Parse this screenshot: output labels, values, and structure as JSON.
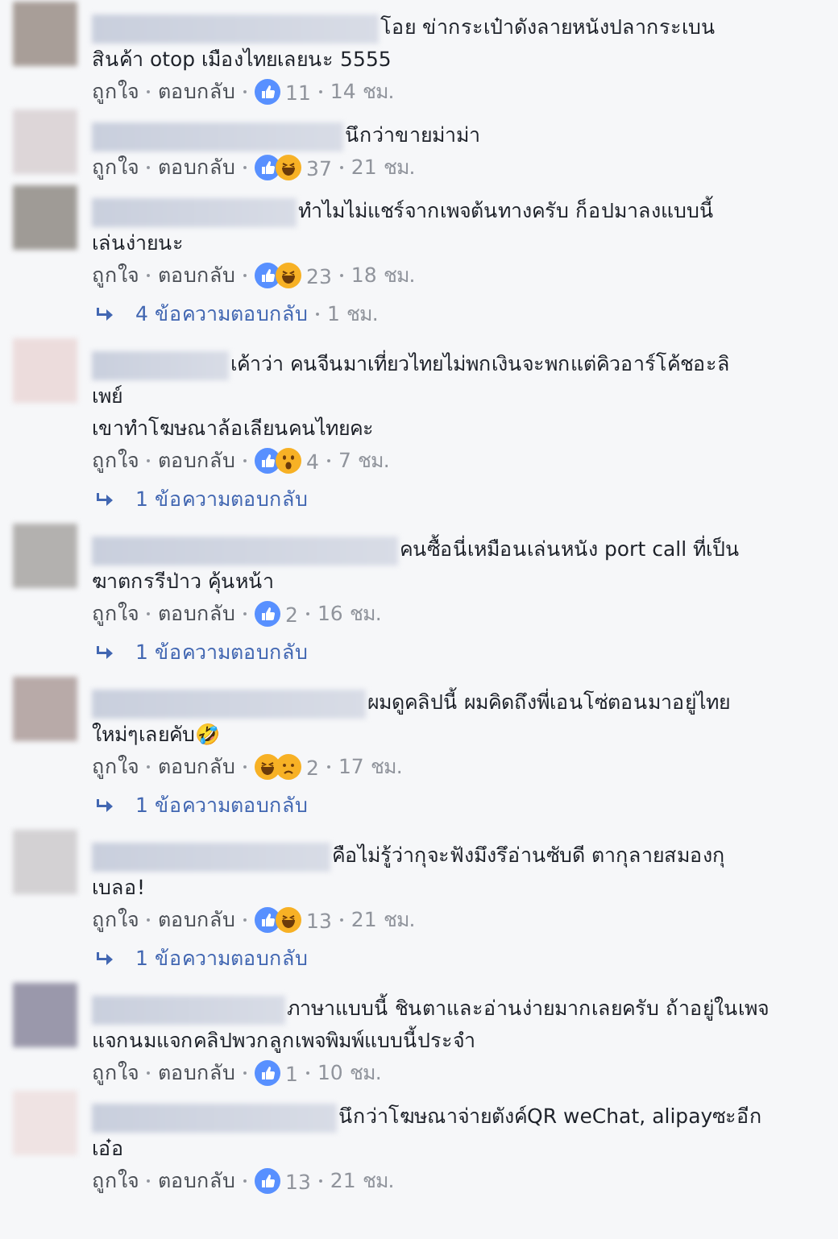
{
  "comments": [
    {
      "lines": [
        "โอย ข่ากระเป๋าดังลายหนังปลากระเบน",
        "สินค้า otop เมืองไทยเลยนะ 5555"
      ],
      "like_label": "ถูกใจ",
      "reply_label": "ตอบกลับ",
      "reactions": [
        {
          "kind": "like"
        }
      ],
      "count": "11",
      "time": "14 ชม."
    },
    {
      "lines": [
        "นึกว่าขายม่าม่า"
      ],
      "like_label": "ถูกใจ",
      "reply_label": "ตอบกลับ",
      "reactions": [
        {
          "kind": "like"
        },
        {
          "kind": "haha"
        }
      ],
      "count": "37",
      "time": "21 ชม."
    },
    {
      "lines": [
        "ทำไมไม่แชร์จากเพจต้นทางครับ ก็อปมาลงแบบนี้",
        "เล่นง่ายนะ"
      ],
      "like_label": "ถูกใจ",
      "reply_label": "ตอบกลับ",
      "reactions": [
        {
          "kind": "like"
        },
        {
          "kind": "haha"
        }
      ],
      "count": "23",
      "time": "18 ชม.",
      "replies": {
        "label": "4 ข้อความตอบกลับ",
        "time": "1 ชม."
      }
    },
    {
      "lines": [
        "เค้าว่า คนจีนมาเที่ยวไทยไม่พกเงินจะพกแต่คิวอาร์โค้ชอะลิ",
        "เพย์",
        "เขาทำโฆษณาล้อเลียนคนไทยคะ"
      ],
      "like_label": "ถูกใจ",
      "reply_label": "ตอบกลับ",
      "reactions": [
        {
          "kind": "like"
        },
        {
          "kind": "wow"
        }
      ],
      "count": "4",
      "time": "7 ชม.",
      "replies": {
        "label": "1 ข้อความตอบกลับ"
      }
    },
    {
      "lines": [
        "คนซื้อนี่เหมือนเล่นหนัง port call ที่เป็น",
        "ฆาตกรรีป่าว คุ้นหน้า"
      ],
      "like_label": "ถูกใจ",
      "reply_label": "ตอบกลับ",
      "reactions": [
        {
          "kind": "like"
        }
      ],
      "count": "2",
      "time": "16 ชม.",
      "replies": {
        "label": "1 ข้อความตอบกลับ"
      }
    },
    {
      "lines": [
        "ผมดูคลิปนี้ ผมคิดถึงพี่เอนโซ่ตอนมาอยู่ไทย",
        "ใหม่ๆเลยคับ🤣"
      ],
      "like_label": "ถูกใจ",
      "reply_label": "ตอบกลับ",
      "reactions": [
        {
          "kind": "haha"
        },
        {
          "kind": "sad"
        }
      ],
      "count": "2",
      "time": "17 ชม.",
      "replies": {
        "label": "1 ข้อความตอบกลับ"
      }
    },
    {
      "lines": [
        "คือไม่รู้ว่ากุจะฟังมึงรึอ่านซับดี ตากุลายสมองกุ",
        "เบลอ!"
      ],
      "like_label": "ถูกใจ",
      "reply_label": "ตอบกลับ",
      "reactions": [
        {
          "kind": "like"
        },
        {
          "kind": "haha"
        }
      ],
      "count": "13",
      "time": "21 ชม.",
      "replies": {
        "label": "1 ข้อความตอบกลับ"
      }
    },
    {
      "lines": [
        "ภาษาแบบนี้ ชินตาและอ่านง่ายมากเลยครับ ถ้าอยู่ในเพจ",
        "แจกนมแจกคลิปพวกลูกเพจพิมพ์แบบนี้ประจำ"
      ],
      "like_label": "ถูกใจ",
      "reply_label": "ตอบกลับ",
      "reactions": [
        {
          "kind": "like"
        }
      ],
      "count": "1",
      "time": "10 ชม."
    },
    {
      "lines": [
        "นึกว่าโฆษณาจ่ายตังค์QR weChat, alipayซะอีก",
        "เอ๋อ"
      ],
      "like_label": "ถูกใจ",
      "reply_label": "ตอบกลับ",
      "reactions": [
        {
          "kind": "like"
        }
      ],
      "count": "13",
      "time": "21 ชม."
    }
  ]
}
